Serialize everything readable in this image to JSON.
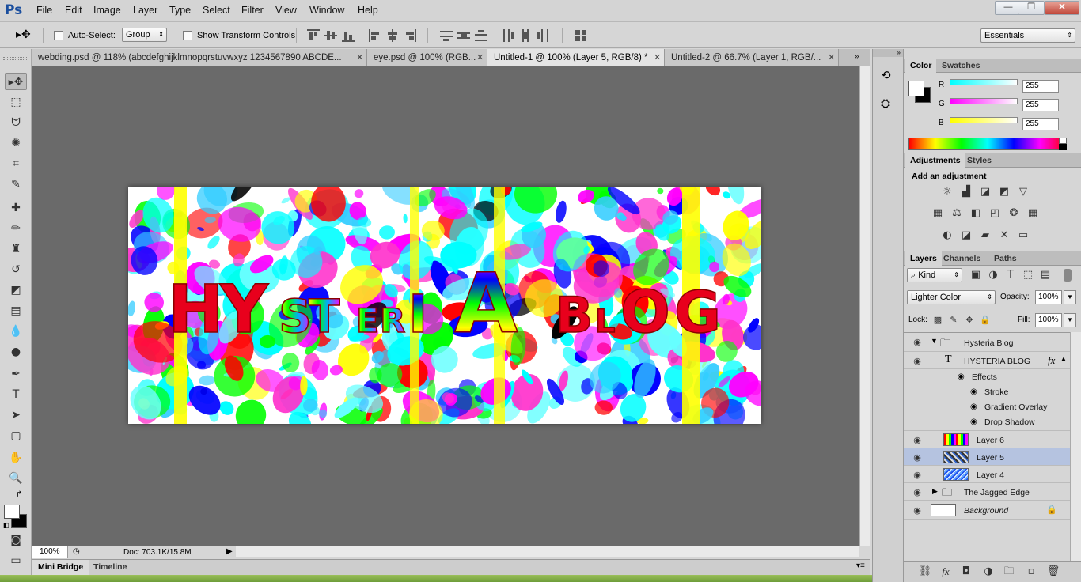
{
  "app": {
    "logo": "Ps"
  },
  "menu": [
    "File",
    "Edit",
    "Image",
    "Layer",
    "Type",
    "Select",
    "Filter",
    "View",
    "Window",
    "Help"
  ],
  "window_controls": {
    "minimize": "—",
    "restore": "❐",
    "close": "✕"
  },
  "options": {
    "auto_select_label": "Auto-Select:",
    "auto_select_value": "Group",
    "show_transform_label": "Show Transform Controls",
    "workspace": "Essentials"
  },
  "tabs": [
    {
      "label": "webding.psd @ 118% (abcdefghijklmnopqrstuvwxyz  1234567890  ABCDE...",
      "active": false
    },
    {
      "label": "eye.psd @ 100% (RGB...",
      "active": false
    },
    {
      "label": "Untitled-1 @ 100% (Layer 5, RGB/8) *",
      "active": true
    },
    {
      "label": "Untitled-2 @ 66.7% (Layer 1, RGB/...",
      "active": false
    }
  ],
  "status": {
    "zoom": "100%",
    "doc": "Doc: 703.1K/15.8M"
  },
  "bottom_tabs": [
    "Mini Bridge",
    "Timeline"
  ],
  "canvas_text": {
    "word1": "HYSTERIA",
    "word2": "BLOG"
  },
  "color_panel": {
    "tabs": [
      "Color",
      "Swatches"
    ],
    "channels": [
      {
        "label": "R",
        "value": "255",
        "color": "#00ffff"
      },
      {
        "label": "G",
        "value": "255",
        "color": "#ff00ff"
      },
      {
        "label": "B",
        "value": "255",
        "color": "#ffff00"
      }
    ]
  },
  "adjustments_panel": {
    "tabs": [
      "Adjustments",
      "Styles"
    ],
    "heading": "Add an adjustment"
  },
  "layers_panel": {
    "tabs": [
      "Layers",
      "Channels",
      "Paths"
    ],
    "filter_kind": "Kind",
    "blend_mode": "Lighter Color",
    "opacity_label": "Opacity:",
    "opacity": "100%",
    "lock_label": "Lock:",
    "fill_label": "Fill:",
    "fill": "100%",
    "layers": [
      {
        "name": "Hysteria Blog",
        "type": "group",
        "expanded": true
      },
      {
        "name": "HYSTERIA BLOG",
        "type": "text",
        "fx": "fx"
      },
      {
        "name": "Effects",
        "type": "effects"
      },
      {
        "name": "Stroke",
        "type": "effect"
      },
      {
        "name": "Gradient Overlay",
        "type": "effect"
      },
      {
        "name": "Drop Shadow",
        "type": "effect"
      },
      {
        "name": "Layer 6",
        "type": "pixel"
      },
      {
        "name": "Layer 5",
        "type": "pixel",
        "selected": true
      },
      {
        "name": "Layer 4",
        "type": "pixel"
      },
      {
        "name": "The Jagged Edge",
        "type": "group",
        "expanded": false
      },
      {
        "name": "Background",
        "type": "background"
      }
    ]
  },
  "colors": {
    "accent": "#b5c3e0",
    "selected_layer": "#b5c3e0",
    "text_red": "#e8001c"
  }
}
